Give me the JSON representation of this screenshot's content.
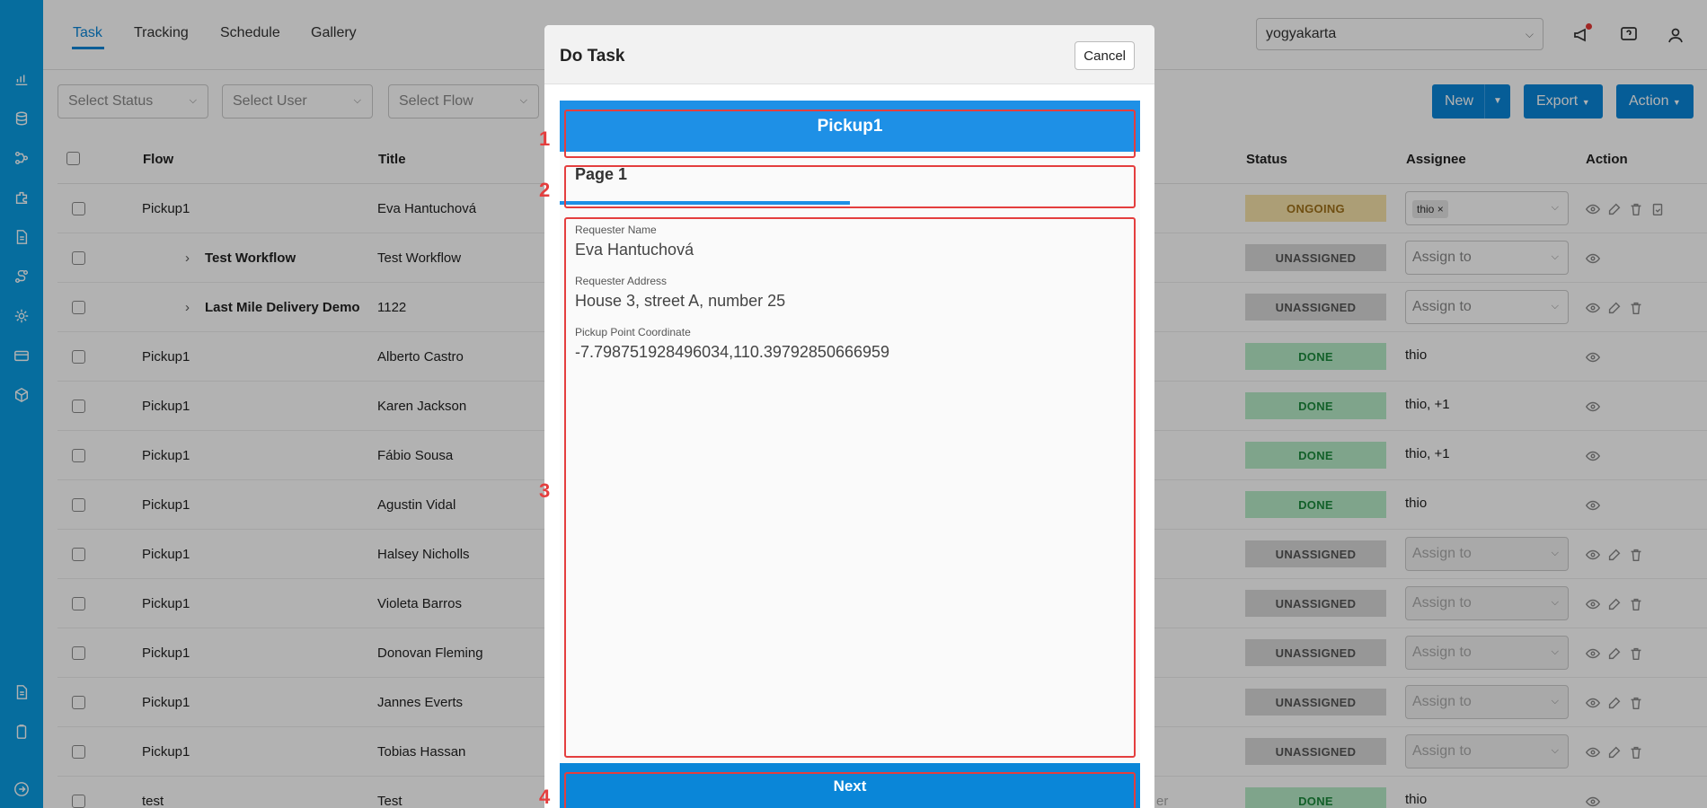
{
  "nav_tabs": [
    {
      "label": "Task",
      "active": true
    },
    {
      "label": "Tracking"
    },
    {
      "label": "Schedule"
    },
    {
      "label": "Gallery"
    }
  ],
  "city_select": {
    "value": "yogyakarta"
  },
  "filters": {
    "status_placeholder": "Select Status",
    "user_placeholder": "Select User",
    "flow_placeholder": "Select Flow"
  },
  "toolbar": {
    "new_label": "New",
    "export_label": "Export",
    "action_label": "Action"
  },
  "columns": {
    "flow": "Flow",
    "title": "Title",
    "status": "Status",
    "assignee": "Assignee",
    "action": "Action"
  },
  "rows": [
    {
      "flow": "Pickup1",
      "title": "Eva Hantuchová",
      "status": "ONGOING",
      "assignee_tag": "thio",
      "assignee_text": ""
    },
    {
      "flow": "Test Workflow",
      "title": "Test Workflow",
      "status": "UNASSIGNED",
      "assignee_text": "Assign to"
    },
    {
      "flow": "Last Mile Delivery Demo",
      "title": "1122",
      "status": "UNASSIGNED",
      "assignee_text": "Assign to"
    },
    {
      "flow": "Pickup1",
      "title": "Alberto Castro",
      "status": "DONE",
      "assignee_text": "thio"
    },
    {
      "flow": "Pickup1",
      "title": "Karen Jackson",
      "status": "DONE",
      "assignee_text": "thio, +1"
    },
    {
      "flow": "Pickup1",
      "title": "Fábio Sousa",
      "status": "DONE",
      "assignee_text": "thio, +1"
    },
    {
      "flow": "Pickup1",
      "title": "Agustin Vidal",
      "status": "DONE",
      "assignee_text": "thio"
    },
    {
      "flow": "Pickup1",
      "title": "Halsey Nicholls",
      "status": "UNASSIGNED",
      "assignee_text": "Assign to"
    },
    {
      "flow": "Pickup1",
      "title": "Violeta Barros",
      "status": "UNASSIGNED",
      "assignee_text": "Assign to"
    },
    {
      "flow": "Pickup1",
      "title": "Donovan Fleming",
      "status": "UNASSIGNED",
      "assignee_text": "Assign to"
    },
    {
      "flow": "Pickup1",
      "title": "Jannes Everts",
      "status": "UNASSIGNED",
      "assignee_text": "Assign to"
    },
    {
      "flow": "Pickup1",
      "title": "Tobias Hassan",
      "status": "UNASSIGNED",
      "assignee_text": "Assign to"
    },
    {
      "flow": "test",
      "title": "Test",
      "status": "DONE",
      "assignee_text": "thio"
    }
  ],
  "partial_text": {
    "er": "er"
  },
  "modal": {
    "title": "Do Task",
    "cancel_label": "Cancel",
    "form_title": "Pickup1",
    "page_label": "Page 1",
    "fields": [
      {
        "label": "Requester Name",
        "value": "Eva Hantuchová"
      },
      {
        "label": "Requester Address",
        "value": "House 3, street A, number 25"
      },
      {
        "label": "Pickup Point Coordinate",
        "value": "-7.798751928496034,110.39792850666959"
      }
    ],
    "next_label": "Next"
  },
  "annotations": [
    "1",
    "2",
    "3",
    "4"
  ]
}
